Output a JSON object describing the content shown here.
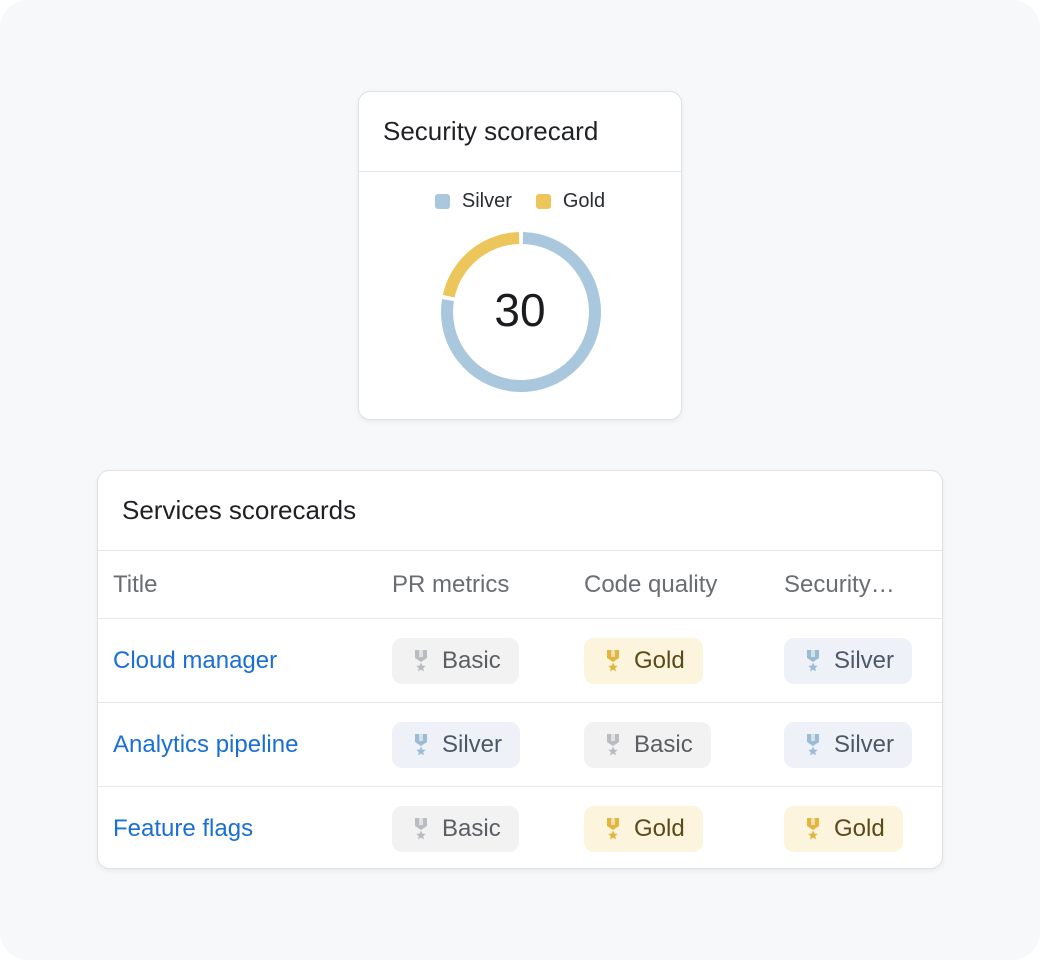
{
  "security_card": {
    "title": "Security scorecard",
    "legend": [
      {
        "label": "Silver",
        "color": "#a9c7dd"
      },
      {
        "label": "Gold",
        "color": "#ecc55b"
      }
    ],
    "total": "30",
    "segments": [
      {
        "name": "Gold",
        "fraction": 0.22,
        "color": "#ecc55b"
      },
      {
        "name": "Silver",
        "fraction": 0.78,
        "color": "#a9c7dd"
      }
    ]
  },
  "services_card": {
    "title": "Services scorecards",
    "columns": [
      "Title",
      "PR metrics",
      "Code quality",
      "Security…"
    ],
    "rows": [
      {
        "title": "Cloud manager",
        "levels": [
          "Basic",
          "Gold",
          "Silver"
        ]
      },
      {
        "title": "Analytics pipeline",
        "levels": [
          "Silver",
          "Basic",
          "Silver"
        ]
      },
      {
        "title": "Feature flags",
        "levels": [
          "Basic",
          "Gold",
          "Gold"
        ]
      }
    ]
  },
  "level_colors": {
    "Basic": "#b9bcc1",
    "Gold": "#e2b53f",
    "Silver": "#9cbcd6"
  }
}
